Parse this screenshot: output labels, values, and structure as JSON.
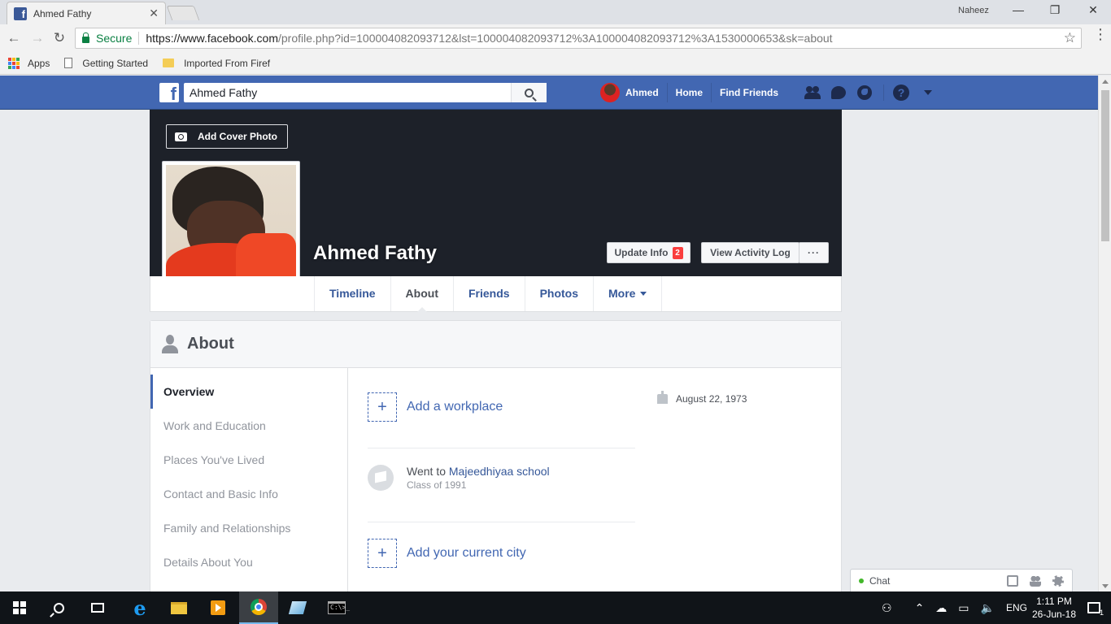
{
  "browser": {
    "tab_title": "Ahmed Fathy",
    "tab_close": "✕",
    "window_user": "Naheez",
    "minimize": "—",
    "maximize": "❐",
    "close": "✕",
    "back": "←",
    "forward": "→",
    "reload": "↻",
    "secure_label": "Secure",
    "url_host": "https://www.facebook.com",
    "url_path": "/profile.php?id=100004082093712&lst=100004082093712%3A100004082093712%3A1530000653&sk=about",
    "star": "☆",
    "menu": "⋮",
    "bookmarks": [
      "Apps",
      "Getting Started",
      "Imported From Firef"
    ],
    "apps_grid_colors": [
      "#ea4335",
      "#fbbc05",
      "#34a853",
      "#4285f4",
      "#ea4335",
      "#fbbc05",
      "#34a853",
      "#4285f4",
      "#ea4335"
    ]
  },
  "fb": {
    "logo_letter": "f",
    "search_value": "Ahmed Fathy",
    "nav": {
      "profile_name": "Ahmed",
      "home": "Home",
      "find_friends": "Find Friends"
    },
    "help_glyph": "?",
    "brand_color": "#4267b2"
  },
  "profile": {
    "add_cover_label": "Add Cover Photo",
    "name": "Ahmed Fathy",
    "update_info_label": "Update Info",
    "update_info_count": "2",
    "view_activity_label": "View Activity Log",
    "more_dots": "···",
    "tabs": [
      "Timeline",
      "About",
      "Friends",
      "Photos",
      "More"
    ]
  },
  "about": {
    "title": "About",
    "side_items": [
      "Overview",
      "Work and Education",
      "Places You've Lived",
      "Contact and Basic Info",
      "Family and Relationships",
      "Details About You"
    ],
    "plus": "+",
    "add_workplace": "Add a workplace",
    "edu_prefix": "Went to ",
    "edu_school": "Majeedhiyaa school",
    "edu_class": "Class of 1991",
    "add_city": "Add your current city",
    "birthday": "August 22, 1973"
  },
  "chat": {
    "label": "Chat"
  },
  "taskbar": {
    "tray_people": "⚇",
    "tray_up": "⌃",
    "tray_cloud": "☁",
    "tray_network": "▭",
    "tray_volume": "🔈",
    "language": "ENG",
    "time": "1:11 PM",
    "date": "26-Jun-18",
    "notif_count": "1",
    "cmd_text": "C:\\>_"
  }
}
